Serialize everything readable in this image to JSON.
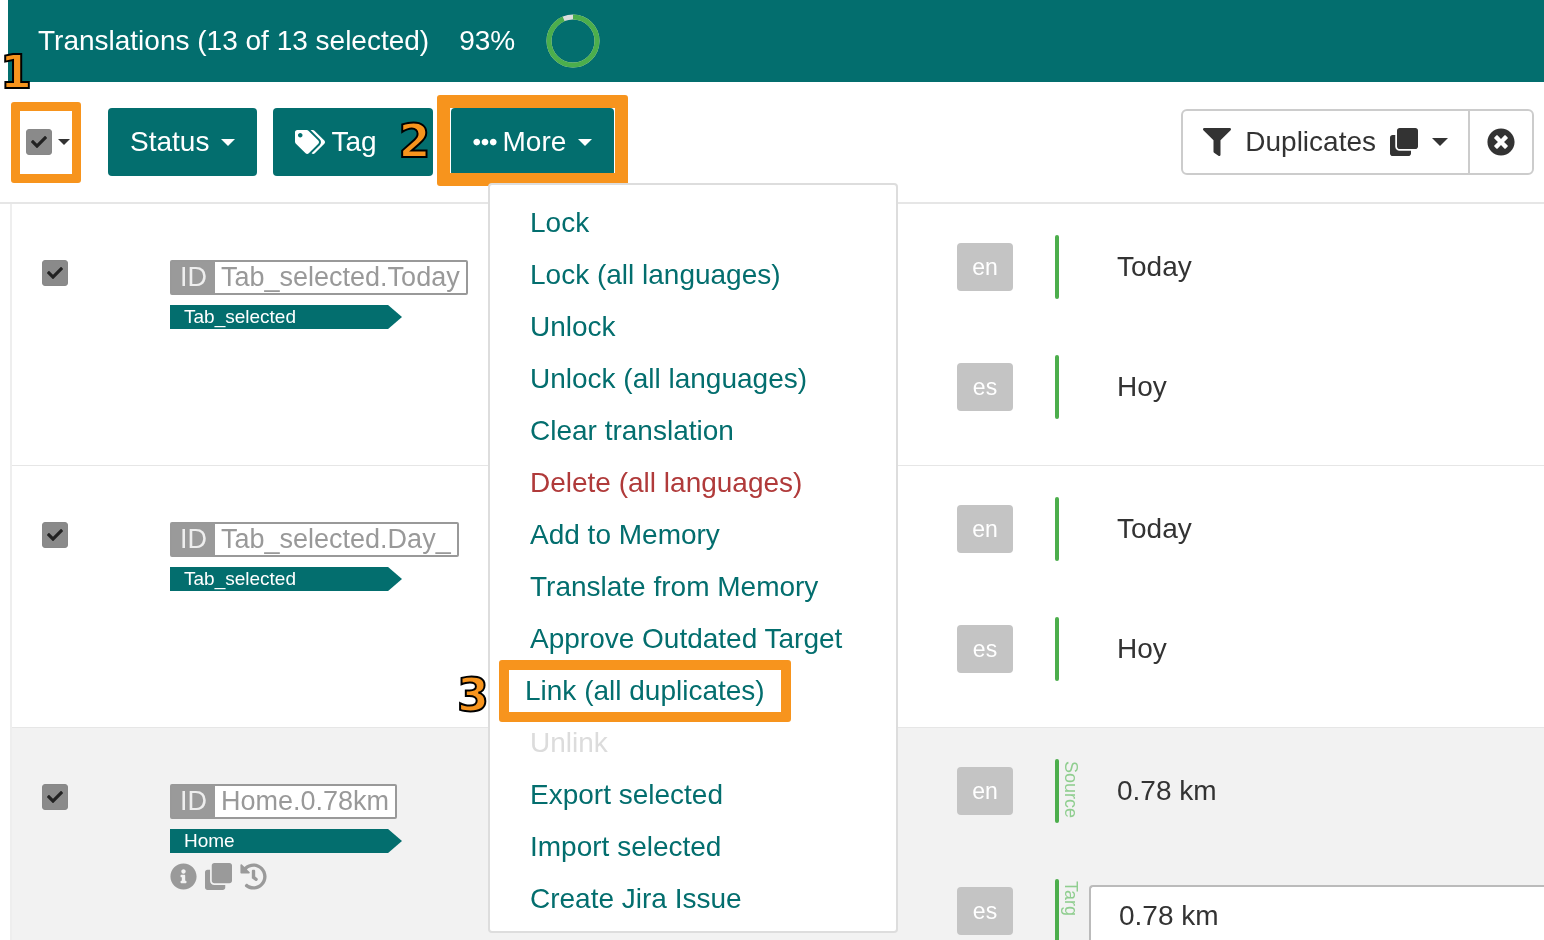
{
  "header": {
    "title": "Translations (13 of 13 selected)",
    "percent": "93%",
    "level": 0.93
  },
  "toolbar": {
    "select_all": {
      "checked": true,
      "callout": "1"
    },
    "buttons": [
      {
        "label": "Status",
        "kind": "dropdown"
      },
      {
        "label": "Tag",
        "kind": "tag"
      },
      {
        "label": "More",
        "kind": "more",
        "callout": "2"
      }
    ],
    "filter": {
      "label": "Duplicates"
    }
  },
  "menu": {
    "items": [
      {
        "label": "Lock",
        "kind": "normal"
      },
      {
        "label": "Lock (all languages)",
        "kind": "normal"
      },
      {
        "label": "Unlock",
        "kind": "normal"
      },
      {
        "label": "Unlock (all languages)",
        "kind": "normal"
      },
      {
        "label": "Clear translation",
        "kind": "normal"
      },
      {
        "label": "Delete (all languages)",
        "kind": "danger"
      },
      {
        "label": "Add to Memory",
        "kind": "normal"
      },
      {
        "label": "Translate from Memory",
        "kind": "normal"
      },
      {
        "label": "Approve Outdated Target",
        "kind": "normal"
      },
      {
        "label": "Link (all duplicates)",
        "kind": "normal",
        "callout": "3"
      },
      {
        "label": "Unlink",
        "kind": "disabled"
      },
      {
        "label": "Export selected",
        "kind": "normal"
      },
      {
        "label": "Import selected",
        "kind": "normal"
      },
      {
        "label": "Create Jira Issue",
        "kind": "normal"
      }
    ]
  },
  "rows": [
    {
      "checked": true,
      "highlighted": false,
      "id_label": "ID",
      "id": "Tab_selected.Today",
      "tag": "Tab_selected",
      "actions_shown": false,
      "translations": [
        {
          "lang": "en",
          "text": "Today",
          "editing": false
        },
        {
          "lang": "es",
          "text": "Hoy",
          "editing": false
        }
      ]
    },
    {
      "checked": true,
      "highlighted": false,
      "id_label": "ID",
      "id": "Tab_selected.Day_",
      "tag": "Tab_selected",
      "actions_shown": false,
      "translations": [
        {
          "lang": "en",
          "text": "Today",
          "editing": false
        },
        {
          "lang": "es",
          "text": "Hoy",
          "editing": false
        }
      ]
    },
    {
      "checked": true,
      "highlighted": true,
      "id_label": "ID",
      "id": "Home.0.78km",
      "tag": "Home",
      "actions_shown": true,
      "translations": [
        {
          "lang": "en",
          "text": "0.78 km",
          "side_label": "Source",
          "editing": false
        },
        {
          "lang": "es",
          "text": "0.78 km",
          "side_label": "Targ",
          "editing": true
        }
      ]
    }
  ]
}
